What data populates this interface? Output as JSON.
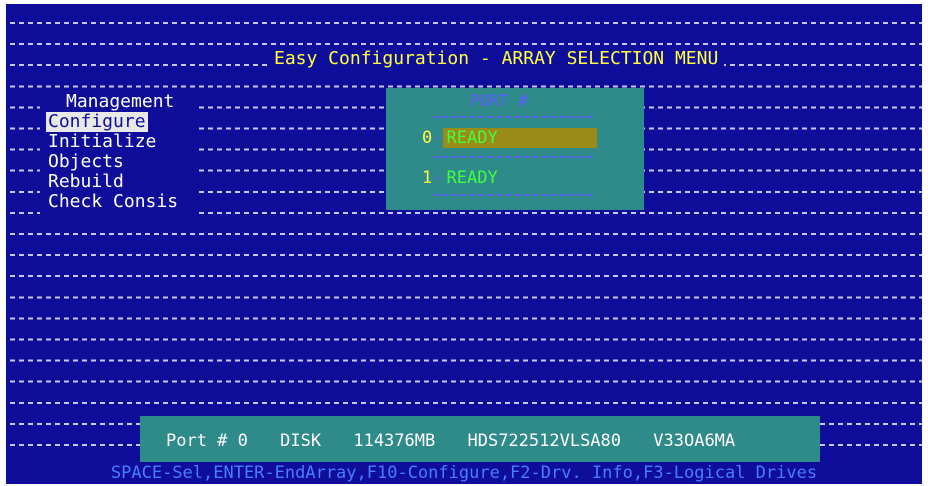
{
  "title": "Easy Configuration - ARRAY SELECTION MENU",
  "menu": {
    "title": "Management",
    "items": [
      {
        "label": "Configure",
        "selected": true
      },
      {
        "label": "Initialize",
        "selected": false
      },
      {
        "label": "Objects",
        "selected": false
      },
      {
        "label": "Rebuild",
        "selected": false
      },
      {
        "label": "Check Consis",
        "selected": false
      }
    ]
  },
  "ports": {
    "header": "PORT #",
    "rows": [
      {
        "index": "0",
        "status": "READY",
        "highlighted": true
      },
      {
        "index": "1",
        "status": "READY",
        "highlighted": false
      }
    ]
  },
  "device": {
    "port": "Port # 0",
    "type": "DISK",
    "size": "114376MB",
    "model": "HDS722512VLSA80",
    "firmware": "V33OA6MA"
  },
  "status_bar": "SPACE-Sel,ENTER-EndArray,F10-Configure,F2-Drv. Info,F3-Logical Drives",
  "colors": {
    "background": "#0e0e9a",
    "panel": "#2f8a8a",
    "title_text": "#ffff40",
    "ready_text": "#40ff40",
    "selected_bar": "#9a8a18"
  }
}
